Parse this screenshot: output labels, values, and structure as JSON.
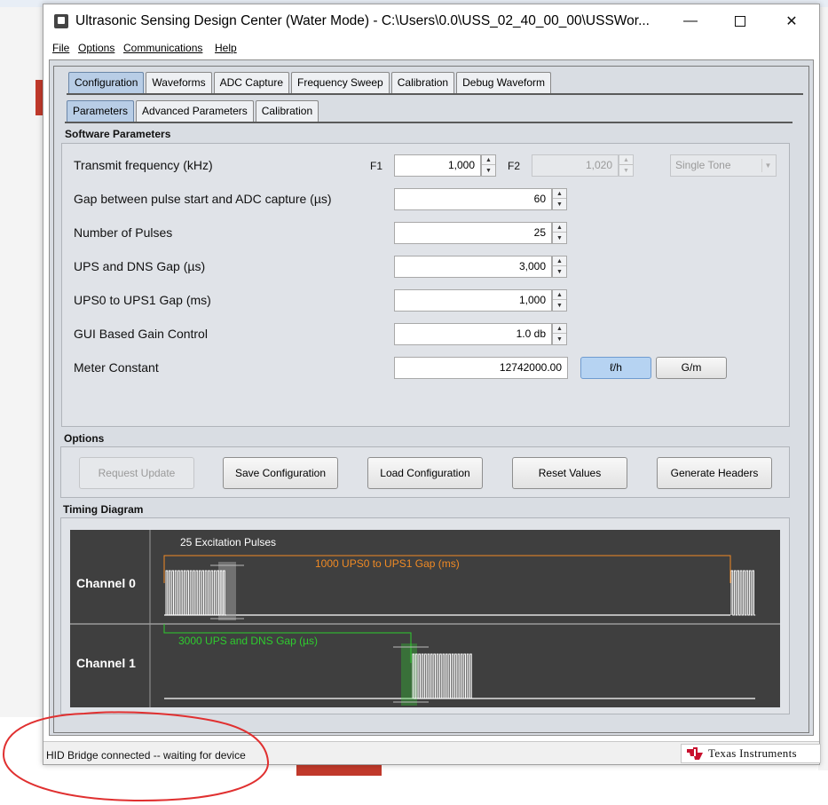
{
  "window": {
    "title": "Ultrasonic Sensing Design Center (Water Mode) - C:\\Users\\0.0\\USS_02_40_00_00\\USSWor...",
    "controls": {
      "minimize": "—",
      "maximize": "",
      "close": "✕"
    }
  },
  "menu": [
    "File",
    "Options",
    "Communications",
    "Help"
  ],
  "main_tabs": [
    "Configuration",
    "Waveforms",
    "ADC Capture",
    "Frequency Sweep",
    "Calibration",
    "Debug Waveform"
  ],
  "sub_tabs": [
    "Parameters",
    "Advanced Parameters",
    "Calibration"
  ],
  "software_parameters": {
    "section_title": "Software Parameters",
    "f1_label": "F1",
    "f2_label": "F2",
    "tone_select": "Single Tone",
    "rows": [
      {
        "label": "Transmit frequency (kHz)",
        "value": "1,000",
        "f2_value": "1,020"
      },
      {
        "label": "Gap between pulse start and ADC capture (µs)",
        "value": "60"
      },
      {
        "label": "Number of Pulses",
        "value": "25"
      },
      {
        "label": "UPS and DNS Gap (µs)",
        "value": "3,000"
      },
      {
        "label": "UPS0 to UPS1 Gap (ms)",
        "value": "1,000"
      },
      {
        "label": "GUI Based Gain Control",
        "value": "1.0 db"
      },
      {
        "label": "Meter Constant",
        "value": "12742000.00"
      }
    ],
    "unit_buttons": [
      "ℓ/h",
      "G/m"
    ]
  },
  "options": {
    "section_title": "Options",
    "buttons": [
      "Request Update",
      "Save Configuration",
      "Load Configuration",
      "Reset Values",
      "Generate Headers"
    ]
  },
  "timing": {
    "section_title": "Timing Diagram",
    "channel0": "Channel 0",
    "channel1": "Channel 1",
    "excitation_label": "25 Excitation Pulses",
    "ups_gap_label": "1000 UPS0 to UPS1 Gap (ms)",
    "dns_gap_label": "3000 UPS and DNS Gap (µs)",
    "colors": {
      "bg": "#3f3f3f",
      "pulse": "#ffffff",
      "ups": "#f08a24",
      "dns": "#2ecc2e",
      "highlight": "#9a9a9a"
    }
  },
  "status": {
    "text": "HID Bridge connected -- waiting for device",
    "logo_text": "Texas Instruments"
  }
}
